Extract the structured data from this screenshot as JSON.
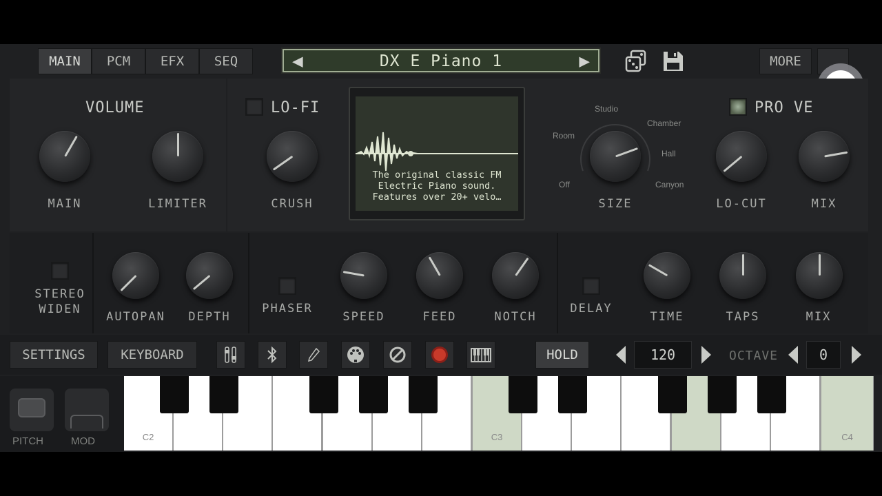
{
  "tabs": [
    "MAIN",
    "PCM",
    "EFX",
    "SEQ"
  ],
  "active_tab": "MAIN",
  "preset": {
    "name": "DX E Piano 1",
    "prev": "◀",
    "next": "▶"
  },
  "more_label": "MORE",
  "volume": {
    "title": "VOLUME",
    "main": "MAIN",
    "limiter": "LIMITER"
  },
  "lofi": {
    "title": "LO-FI",
    "crush": "CRUSH"
  },
  "display": {
    "desc_lines": [
      "The original classic FM",
      "Electric Piano sound.",
      "Features over 20+ velo…"
    ]
  },
  "reverb": {
    "size": "SIZE",
    "locut": "LO-CUT",
    "mix": "MIX",
    "title": "PRO VE",
    "modes": [
      "Studio",
      "Chamber",
      "Room",
      "Hall",
      "Off",
      "Canyon"
    ]
  },
  "effects": {
    "stereo": [
      "STEREO",
      "WIDEN"
    ],
    "autopan": "AUTOPAN",
    "depth": "DEPTH",
    "phaser": "PHASER",
    "speed": "SPEED",
    "feed": "FEED",
    "notch": "NOTCH",
    "delay": "DELAY",
    "time": "TIME",
    "taps": "TAPS",
    "mix": "MIX"
  },
  "toolbar": {
    "settings": "SETTINGS",
    "keyboard": "KEYBOARD",
    "hold": "HOLD",
    "tempo": "120",
    "octave_label": "OCTAVE",
    "octave": "0",
    "icons": [
      "sliders-icon",
      "bluetooth-icon",
      "pencil-icon",
      "midi-icon",
      "block-icon",
      "record-icon",
      "keyboard-icon"
    ]
  },
  "wheels": {
    "pitch": "PITCH",
    "mod": "MOD"
  },
  "keys": {
    "c2": "C2",
    "c3": "C3",
    "c4": "C4"
  },
  "colors": {
    "lcd": "#dfe6d2",
    "display_bg": "#2f352c",
    "highlight_key": "#cfd9c6"
  }
}
